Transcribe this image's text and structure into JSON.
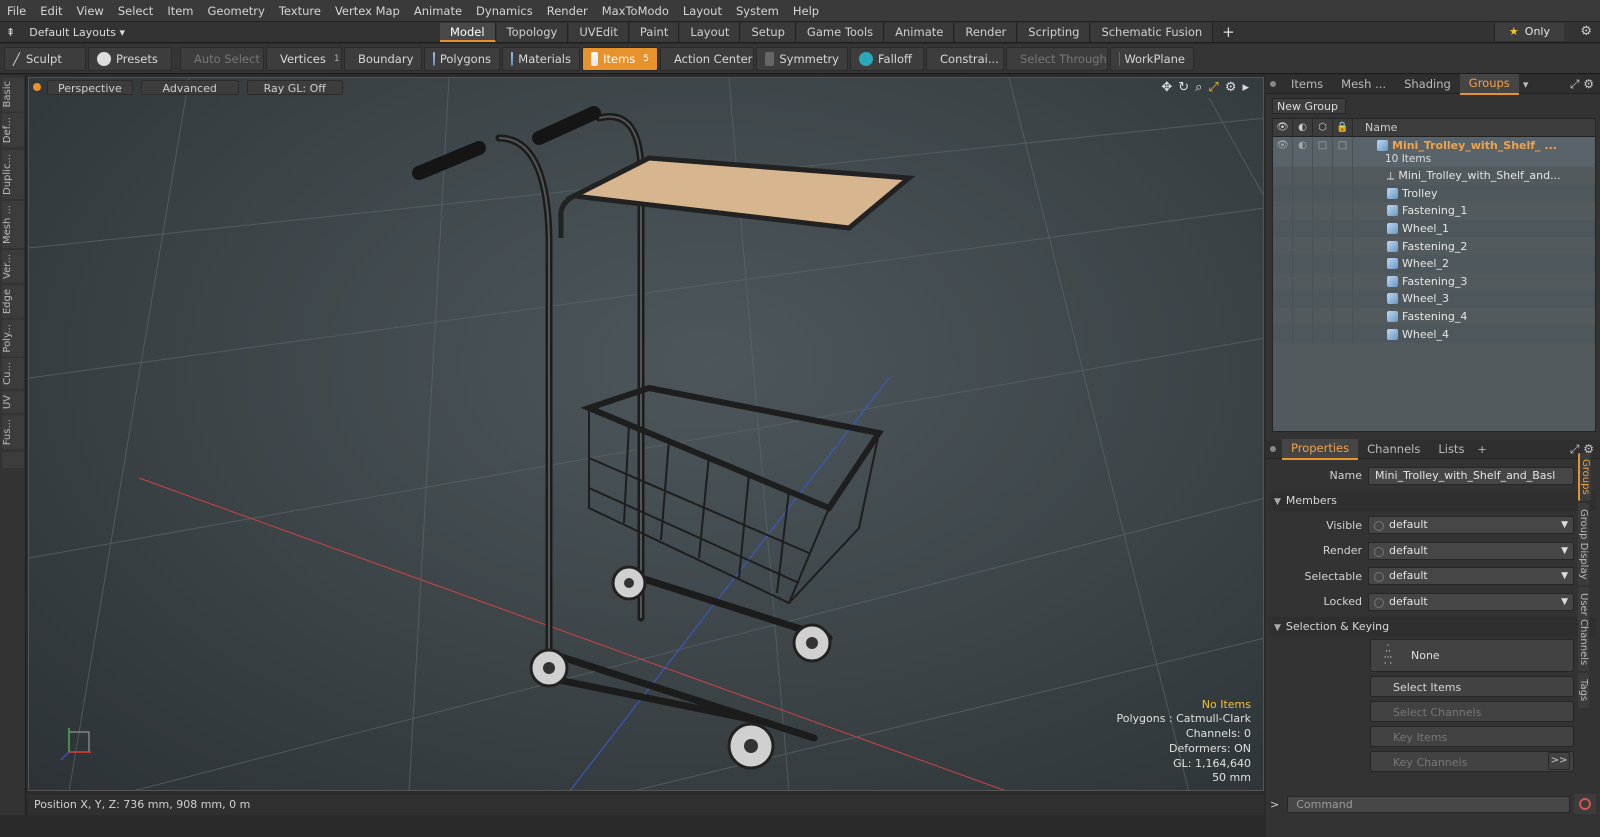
{
  "menu": [
    "File",
    "Edit",
    "View",
    "Select",
    "Item",
    "Geometry",
    "Texture",
    "Vertex Map",
    "Animate",
    "Dynamics",
    "Render",
    "MaxToModo",
    "Layout",
    "System",
    "Help"
  ],
  "layout_select": "Default Layouts",
  "tabs": [
    {
      "label": "Model",
      "active": true
    },
    {
      "label": "Topology",
      "active": false
    },
    {
      "label": "UVEdit",
      "active": false
    },
    {
      "label": "Paint",
      "active": false
    },
    {
      "label": "Layout",
      "active": false
    },
    {
      "label": "Setup",
      "active": false
    },
    {
      "label": "Game Tools",
      "active": false
    },
    {
      "label": "Animate",
      "active": false
    },
    {
      "label": "Render",
      "active": false
    },
    {
      "label": "Scripting",
      "active": false
    },
    {
      "label": "Schematic Fusion",
      "active": false
    }
  ],
  "only_label": "Only",
  "toolbar": {
    "sculpt": "Sculpt",
    "presets": "Presets",
    "auto_select": "Auto Select",
    "vertices": "Vertices",
    "vertices_count": "1",
    "boundary": "Boundary",
    "polygons": "Polygons",
    "materials": "Materials",
    "items": "Items",
    "items_count": "5",
    "action_center": "Action Center",
    "symmetry": "Symmetry",
    "falloff": "Falloff",
    "constraints": "Constrai...",
    "select_through": "Select Through",
    "workplane": "WorkPlane"
  },
  "left_tabs": [
    "Basic",
    "Def...",
    "Duplic...",
    "Mesh ...",
    "Ver...",
    "Edge",
    "Poly...",
    "Cu...",
    "UV",
    "Fus..."
  ],
  "viewport": {
    "perspective": "Perspective",
    "advanced": "Advanced",
    "raygl": "Ray GL: Off",
    "info": {
      "no_items": "No Items",
      "polygons": "Polygons : Catmull-Clark",
      "channels": "Channels: 0",
      "deformers": "Deformers: ON",
      "gl": "GL: 1,164,640",
      "focal": "50 mm"
    }
  },
  "status": "Position X, Y, Z:  736 mm, 908 mm, 0 m",
  "right_tabs": [
    {
      "label": "Items",
      "active": false
    },
    {
      "label": "Mesh ...",
      "active": false
    },
    {
      "label": "Shading",
      "active": false
    },
    {
      "label": "Groups",
      "active": true
    }
  ],
  "new_group": "New Group",
  "tree": {
    "name_header": "Name",
    "group_title": "Mini_Trolley_with_Shelf_ ...",
    "group_count": "10 Items",
    "items": [
      "Mini_Trolley_with_Shelf_and...",
      "Trolley",
      "Fastening_1",
      "Wheel_1",
      "Fastening_2",
      "Wheel_2",
      "Fastening_3",
      "Wheel_3",
      "Fastening_4",
      "Wheel_4"
    ]
  },
  "props_tabs": [
    {
      "label": "Properties",
      "active": true
    },
    {
      "label": "Channels",
      "active": false
    },
    {
      "label": "Lists",
      "active": false
    }
  ],
  "props": {
    "name_label": "Name",
    "name_value": "Mini_Trolley_with_Shelf_and_Basl",
    "members": "Members",
    "visible_label": "Visible",
    "visible_value": "default",
    "render_label": "Render",
    "render_value": "default",
    "selectable_label": "Selectable",
    "selectable_value": "default",
    "locked_label": "Locked",
    "locked_value": "default",
    "sel_keying": "Selection & Keying",
    "none": "None",
    "select_items": "Select Items",
    "select_channels": "Select Channels",
    "key_items": "Key Items",
    "key_channels": "Key Channels",
    "more": ">>"
  },
  "side_tabs": [
    "Groups",
    "Group Display",
    "User Channels",
    "Tags"
  ],
  "command_placeholder": "Command",
  "colors": {
    "accent": "#e8922b",
    "group_title": "#f0a34a",
    "warn": "#f1c232"
  }
}
